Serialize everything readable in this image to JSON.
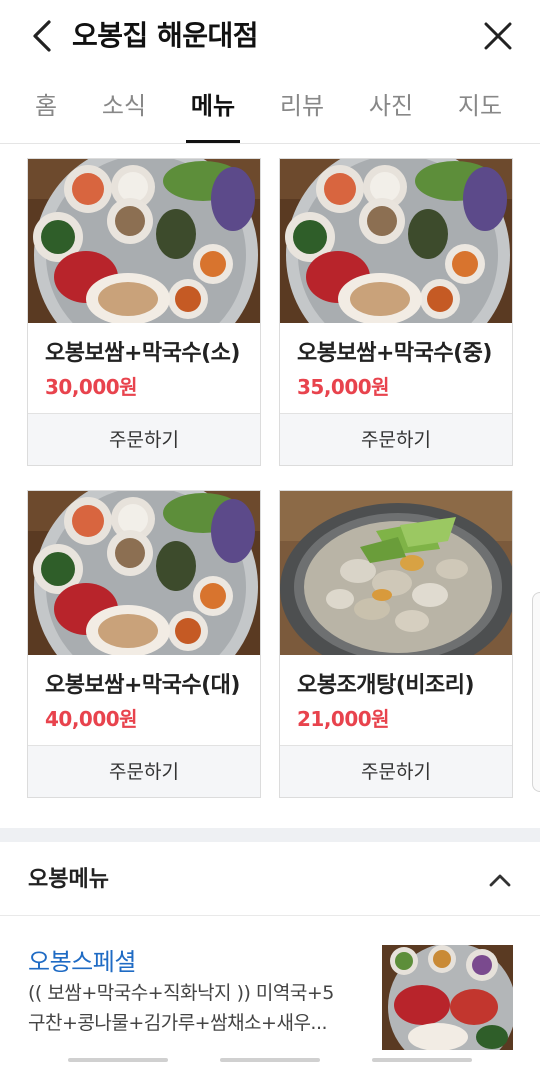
{
  "header": {
    "title": "오봉집 해운대점",
    "back_icon": "chevron-left-icon",
    "close_icon": "close-icon"
  },
  "tabs": [
    {
      "label": "홈",
      "active": false
    },
    {
      "label": "소식",
      "active": false
    },
    {
      "label": "메뉴",
      "active": true
    },
    {
      "label": "리뷰",
      "active": false
    },
    {
      "label": "사진",
      "active": false
    },
    {
      "label": "지도",
      "active": false
    }
  ],
  "menu_cards": [
    {
      "name": "오봉보쌈+막국수(소)",
      "price": "30,000원",
      "order_label": "주문하기",
      "photo": "bossam-platter-photo"
    },
    {
      "name": "오봉보쌈+막국수(중)",
      "price": "35,000원",
      "order_label": "주문하기",
      "photo": "bossam-platter-photo"
    },
    {
      "name": "오봉보쌈+막국수(대)",
      "price": "40,000원",
      "order_label": "주문하기",
      "photo": "bossam-platter-photo"
    },
    {
      "name": "오봉조개탕(비조리)",
      "price": "21,000원",
      "order_label": "주문하기",
      "photo": "clam-soup-photo"
    }
  ],
  "section": {
    "title": "오봉메뉴",
    "collapse_icon": "chevron-up-icon"
  },
  "special": {
    "name": "오봉스페셜",
    "desc_line1": "(( 보쌈+막국수+직화낙지 )) 미역국+5",
    "desc_line2": "구찬+콩나물+김가루+쌈채소+새우...",
    "photo": "special-platter-photo"
  },
  "colors": {
    "price": "#e8434d",
    "link": "#1f6bc4",
    "active_tab": "#111111"
  }
}
